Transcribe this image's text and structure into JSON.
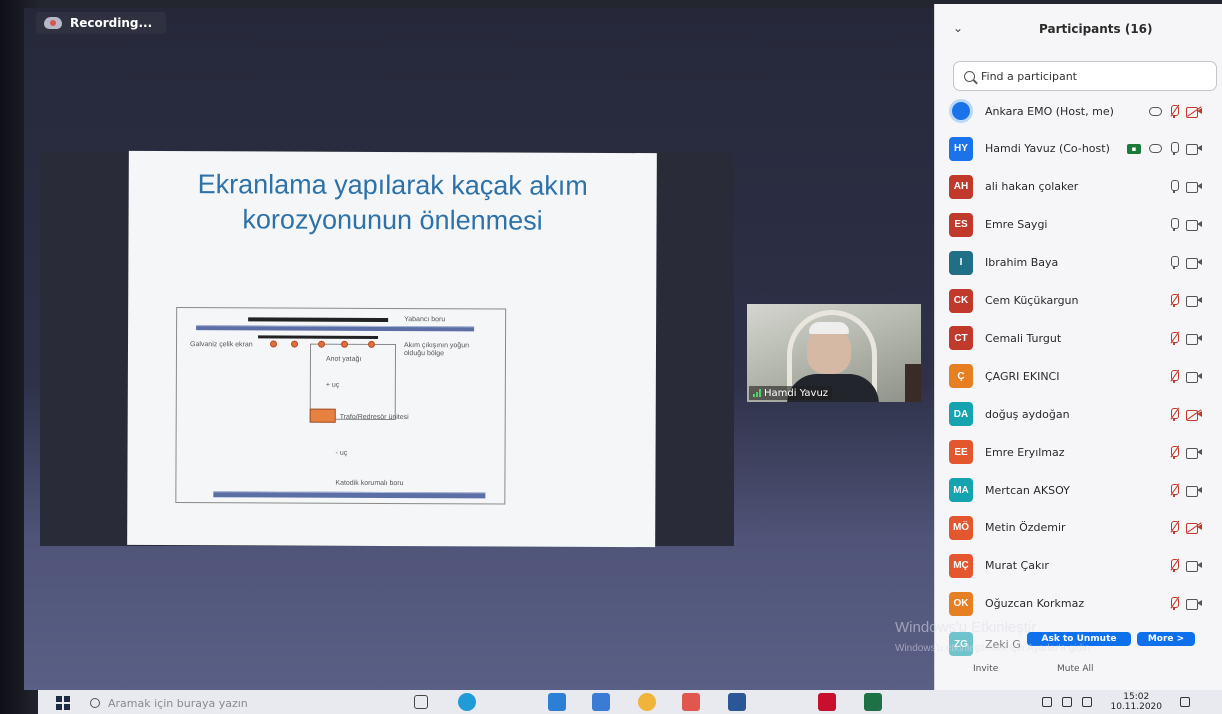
{
  "recording": {
    "label": "Recording..."
  },
  "slide": {
    "title_line1": "Ekranlama yapılarak kaçak akım",
    "title_line2": "korozyonunun önlenmesi",
    "labels": {
      "foreign_pipe": "Yabancı boru",
      "galvanized_screen": "Galvaniz çelik ekran",
      "high_current_zone_1": "Akım çıkışının yoğun",
      "high_current_zone_2": "olduğu bölge",
      "anode_bed": "Anot yatağı",
      "plus_end": "+ uç",
      "rectifier": "Trafo/Redresör ünitesi",
      "minus_end": "- uç",
      "protected_pipe": "Katodik korumalı boru"
    },
    "colors": {
      "title": "#2d72a8",
      "node": "#e06f3c",
      "rectifier": "#e6813f",
      "pipe": "#5b6fa6"
    }
  },
  "video": {
    "name": "Hamdi Yavuz"
  },
  "panel": {
    "title": "Participants (16)",
    "search_placeholder": "Find a participant",
    "participants": [
      {
        "initials": "",
        "name": "Ankara EMO (Host, me)",
        "color": "#1a73e8",
        "mic": "muted",
        "cam": "off",
        "cloud": true,
        "cc": false,
        "logo": true
      },
      {
        "initials": "HY",
        "name": "Hamdi Yavuz (Co-host)",
        "color": "#1a73e8",
        "mic": "on",
        "cam": "on",
        "cloud": true,
        "cc": true
      },
      {
        "initials": "AH",
        "name": "ali hakan çolaker",
        "color": "#c0392b",
        "mic": "on",
        "cam": "on"
      },
      {
        "initials": "ES",
        "name": "Emre Saygi",
        "color": "#c0392b",
        "mic": "on",
        "cam": "on"
      },
      {
        "initials": "I",
        "name": "Ibrahim Baya",
        "color": "#1f6f86",
        "mic": "on",
        "cam": "on"
      },
      {
        "initials": "CK",
        "name": "Cem Küçükargun",
        "color": "#c0392b",
        "mic": "muted",
        "cam": "on"
      },
      {
        "initials": "CT",
        "name": "Cemali Turgut",
        "color": "#c0392b",
        "mic": "muted",
        "cam": "on"
      },
      {
        "initials": "Ç",
        "name": "ÇAGRI EKINCI",
        "color": "#e67e22",
        "mic": "muted",
        "cam": "on"
      },
      {
        "initials": "DA",
        "name": "doğuş aydoğan",
        "color": "#16a3b0",
        "mic": "muted",
        "cam": "off"
      },
      {
        "initials": "EE",
        "name": "Emre Eryılmaz",
        "color": "#e4572e",
        "mic": "muted",
        "cam": "on"
      },
      {
        "initials": "MA",
        "name": "Mertcan AKSOY",
        "color": "#16a3b0",
        "mic": "muted",
        "cam": "on"
      },
      {
        "initials": "MÖ",
        "name": "Metin Özdemir",
        "color": "#e4572e",
        "mic": "muted",
        "cam": "off"
      },
      {
        "initials": "MÇ",
        "name": "Murat Çakır",
        "color": "#e4572e",
        "mic": "muted",
        "cam": "on"
      },
      {
        "initials": "OK",
        "name": "Oğuzcan Korkmaz",
        "color": "#e67e22",
        "mic": "muted",
        "cam": "on"
      }
    ],
    "footer": {
      "partial_row_initials": "ZG",
      "partial_row_name": "Zeki G",
      "ask_to_unmute": "Ask to Unmute",
      "more": "More >",
      "invite": "Invite",
      "mute_all": "Mute All"
    }
  },
  "watermark": {
    "line1": "Windows'u Etkinleştir",
    "line2": "Windows'u etkinleştirmek için Ayarlar'a gidin."
  },
  "taskbar": {
    "search_placeholder": "Aramak için buraya yazın",
    "time": "15:02",
    "date": "10.11.2020"
  }
}
